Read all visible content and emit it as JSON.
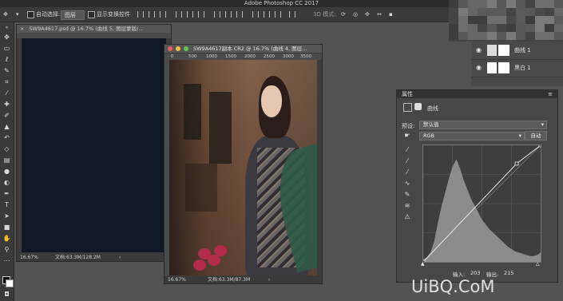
{
  "app": {
    "title": "Adobe Photoshop CC 2017"
  },
  "options_bar": {
    "auto_select_label": "自动选择:",
    "auto_select_value": "图层",
    "show_transform_label": "显示变换控件",
    "mode_3d_label": "3D 模式:"
  },
  "layers": [
    {
      "name": "曲线 1"
    },
    {
      "name": "黑白 1"
    }
  ],
  "doc1": {
    "tab_title": "SW9A4617.psd @ 16.7% (曲线 5, 图层蒙版/...",
    "status_zoom": "16.67%",
    "status_doc": "文档:63.3M/128.2M",
    "status_arrow": "›"
  },
  "doc2": {
    "title": "SW9A4617副本.CR2 @ 16.7% (曲线 4, 图层...",
    "ruler_ticks": [
      "0",
      "500",
      "1000",
      "1500",
      "2000",
      "2500",
      "3000",
      "3500"
    ],
    "status_zoom": "16.67%",
    "status_doc": "文档:63.3M/87.3M",
    "status_arrow": "›"
  },
  "properties": {
    "header": "属性",
    "panel_name": "曲线",
    "preset_label": "预设:",
    "preset_value": "默认值",
    "channel_value": "RGB",
    "auto_button": "自动",
    "input_label": "输入:",
    "input_value": "203",
    "output_label": "输出:",
    "output_value": "215"
  },
  "chart_data": {
    "type": "area",
    "x": [
      0,
      8,
      16,
      24,
      32,
      40,
      48,
      56,
      64,
      72,
      80,
      88,
      96,
      104,
      112,
      120,
      128,
      136,
      144,
      152,
      160,
      168,
      176,
      184,
      192,
      200,
      208,
      216,
      224,
      232,
      240,
      248,
      255
    ],
    "values": [
      2,
      4,
      8,
      18,
      34,
      48,
      60,
      72,
      82,
      88,
      80,
      70,
      62,
      54,
      48,
      42,
      36,
      32,
      28,
      25,
      22,
      19,
      16,
      13,
      11,
      9,
      8,
      7,
      6,
      5,
      5,
      6,
      8
    ],
    "curve_points": [
      [
        0,
        0
      ],
      [
        203,
        215
      ],
      [
        255,
        255
      ]
    ],
    "xlim": [
      0,
      255
    ],
    "ylim": [
      0,
      255
    ]
  },
  "watermark": {
    "text": "UiBQ.CoM"
  }
}
